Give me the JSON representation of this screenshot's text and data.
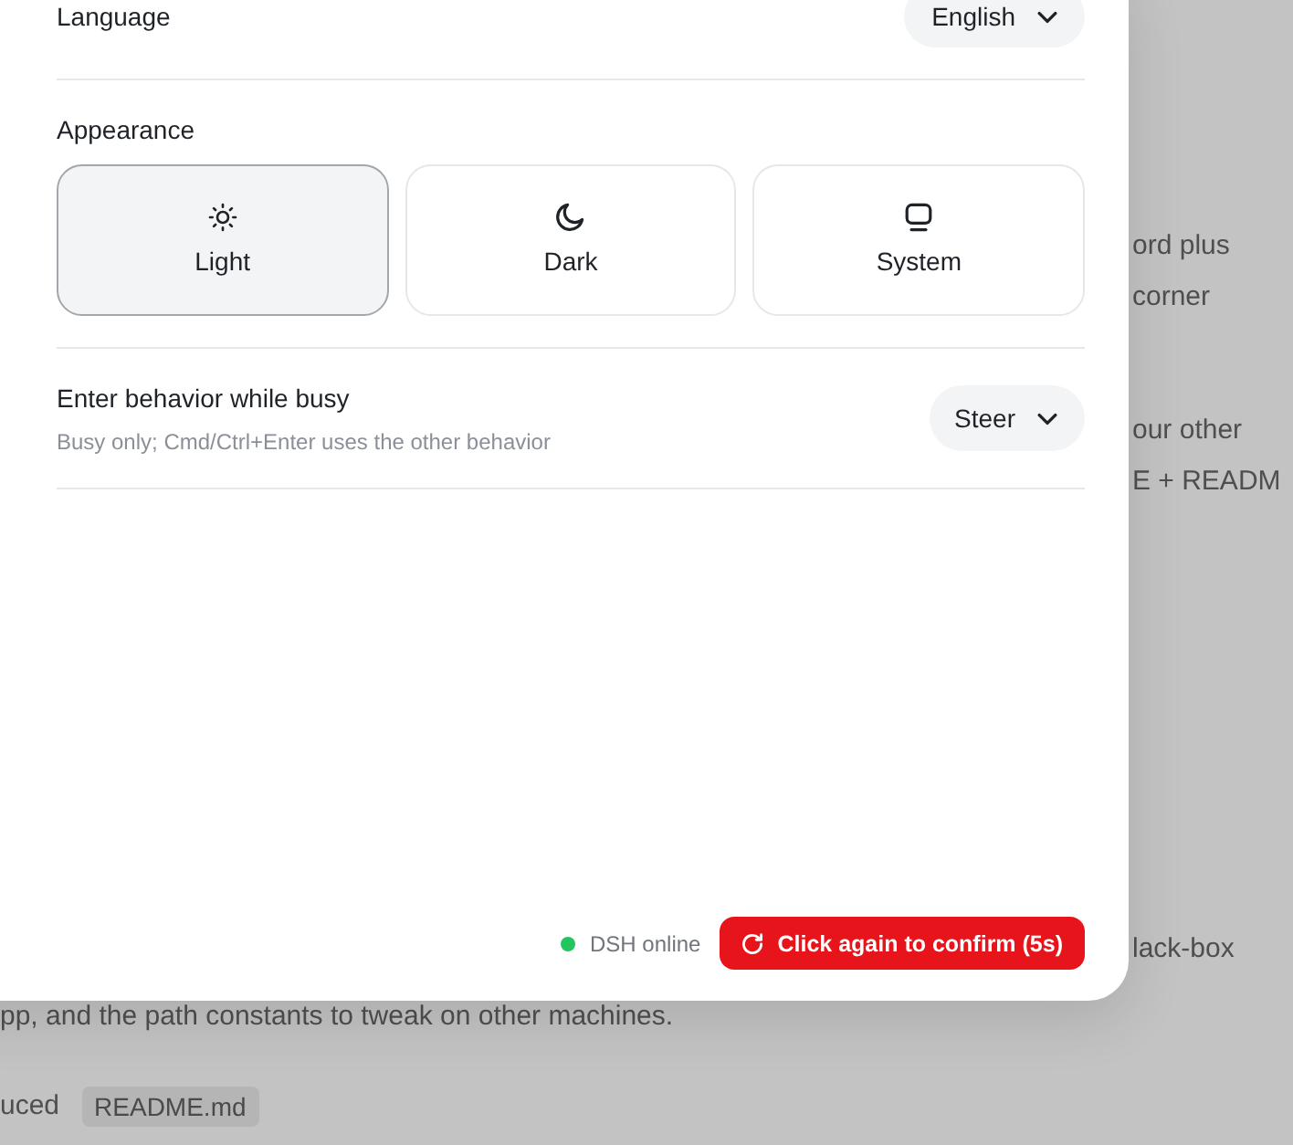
{
  "backdrop": {
    "paragraphs": [
      [
        "ord plus",
        "corner"
      ],
      [
        "our other",
        "E + READM"
      ],
      [
        "lack-box"
      ]
    ],
    "continuation": "pp, and the path constants to tweak on other machines.",
    "last_line": {
      "text": "uced",
      "chip": "README.md"
    }
  },
  "language": {
    "label": "Language",
    "value": "English"
  },
  "appearance": {
    "label": "Appearance",
    "options": [
      {
        "kind": "light",
        "label": "Light",
        "selected": true
      },
      {
        "kind": "dark",
        "label": "Dark",
        "selected": false
      },
      {
        "kind": "system",
        "label": "System",
        "selected": false
      }
    ]
  },
  "enter_behavior": {
    "label": "Enter behavior while busy",
    "description": "Busy only; Cmd/Ctrl+Enter uses the other behavior",
    "value": "Steer"
  },
  "footer": {
    "status": {
      "label": "DSH online",
      "online": true
    },
    "confirm_button": {
      "label": "Click again to confirm (5s)"
    }
  }
}
